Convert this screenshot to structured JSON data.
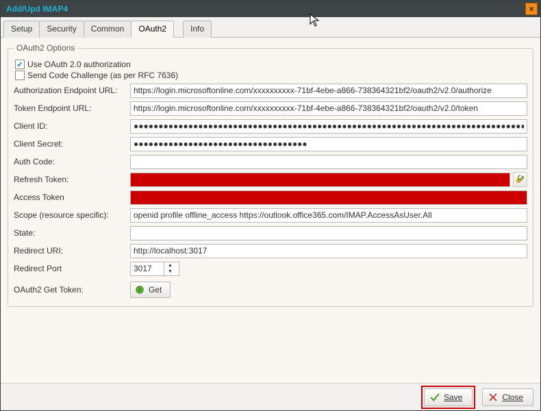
{
  "window": {
    "title": "Add/Upd IMAP4"
  },
  "tabs": {
    "setup": "Setup",
    "security": "Security",
    "common": "Common",
    "oauth2": "OAuth2",
    "info": "Info",
    "active": "oauth2"
  },
  "group": {
    "legend": "OAuth2 Options"
  },
  "checks": {
    "use_oauth_label": "Use OAuth 2.0 authorization",
    "use_oauth_checked": true,
    "code_challenge_label": "Send Code Challenge (as per RFC 7636)",
    "code_challenge_checked": false
  },
  "labels": {
    "auth_endpoint": "Authorization Endpoint URL:",
    "token_endpoint": "Token Endpoint URL:",
    "client_id": "Client ID:",
    "client_secret": "Client Secret:",
    "auth_code": "Auth Code:",
    "refresh_token": "Refresh Token:",
    "access_token": "Access Token",
    "scope": "Scope (resource specific):",
    "state": "State:",
    "redirect_uri": "Redirect URI:",
    "redirect_port": "Redirect Port",
    "get_token": "OAuth2 Get Token:"
  },
  "values": {
    "auth_endpoint": "https://login.microsoftonline.com/xxxxxxxxxx-71bf-4ebe-a866-738364321bf2/oauth2/v2.0/authorize",
    "token_endpoint": "https://login.microsoftonline.com/xxxxxxxxxx-71bf-4ebe-a866-738364321bf2/oauth2/v2.0/token",
    "client_id": "●●●●●●●●●●●●●●●●●●●●●●●●●●●●●●●●●●●●●●●●●●●●●●●●●●●●●●●●●●●●●●●●●●●●●●●●●●●●●●●●●●●●●●",
    "client_secret": "●●●●●●●●●●●●●●●●●●●●●●●●●●●●●●●●●●●",
    "auth_code": "",
    "refresh_token": "",
    "access_token": "",
    "scope": "openid profile offline_access https://outlook.office365.com/IMAP.AccessAsUser.All",
    "state": "",
    "redirect_uri": "http://localhost:3017",
    "redirect_port": "3017"
  },
  "buttons": {
    "get": "Get",
    "save": "Save",
    "close": "Close"
  },
  "icons": {
    "close_window": "✕",
    "refresh_action": "refresh-token-icon"
  }
}
